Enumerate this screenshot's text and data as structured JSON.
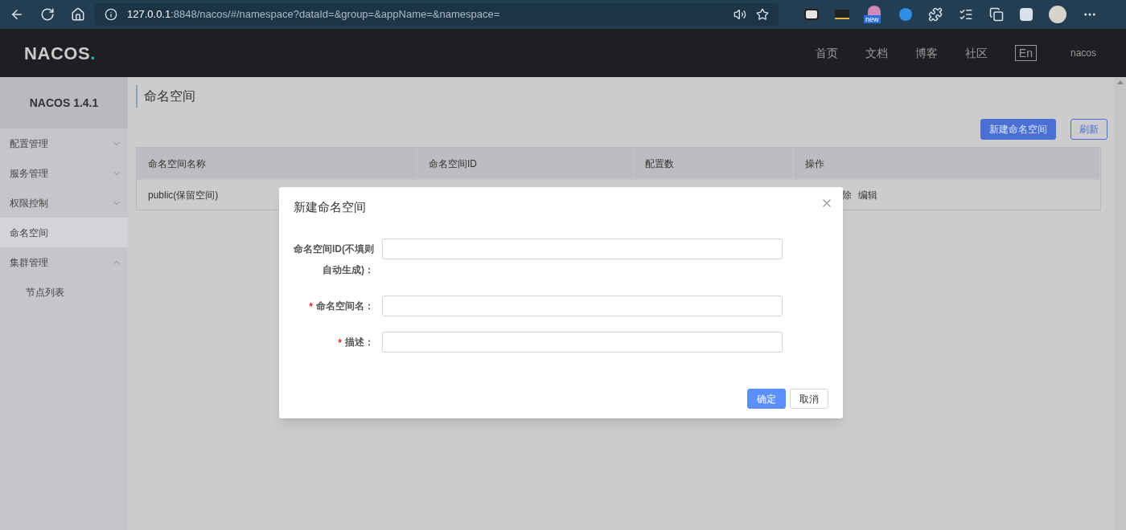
{
  "browser": {
    "url_host": "127.0.0.1",
    "url_rest": ":8848/nacos/#/namespace?dataId=&group=&appName=&namespace=",
    "badge": "new"
  },
  "header": {
    "logo": "NACOS.",
    "nav": [
      "首页",
      "文档",
      "博客",
      "社区"
    ],
    "lang": "En",
    "user": "nacos"
  },
  "sidebar": {
    "title": "NACOS 1.4.1",
    "items": [
      {
        "label": "配置管理",
        "kind": "group",
        "expanded": false,
        "selected": false
      },
      {
        "label": "服务管理",
        "kind": "group",
        "expanded": false,
        "selected": false
      },
      {
        "label": "权限控制",
        "kind": "group",
        "expanded": false,
        "selected": false
      },
      {
        "label": "命名空间",
        "kind": "link",
        "selected": true
      },
      {
        "label": "集群管理",
        "kind": "group",
        "expanded": true,
        "selected": false,
        "children": [
          {
            "label": "节点列表",
            "selected": false
          }
        ]
      }
    ]
  },
  "page": {
    "title": "命名空间",
    "buttons": [
      {
        "label": "新建命名空间",
        "kind": "primary"
      },
      {
        "label": "刷新",
        "kind": "secondary"
      }
    ],
    "table": {
      "columns": [
        "命名空间名称",
        "命名空间ID",
        "配置数",
        "操作"
      ],
      "rows": [
        {
          "name": "public(保留空间)",
          "actions": [
            "除",
            "编辑"
          ]
        }
      ]
    }
  },
  "dialog": {
    "title": "新建命名空间",
    "fields": [
      {
        "label": "命名空间ID(不填则自动生成)："
      },
      {
        "label": "命名空间名：",
        "required_mark": "*"
      },
      {
        "label": "描述：",
        "required_mark": "*"
      }
    ],
    "buttons": [
      {
        "label": "确定",
        "kind": "primary"
      },
      {
        "label": "取消",
        "kind": "secondary"
      }
    ]
  }
}
